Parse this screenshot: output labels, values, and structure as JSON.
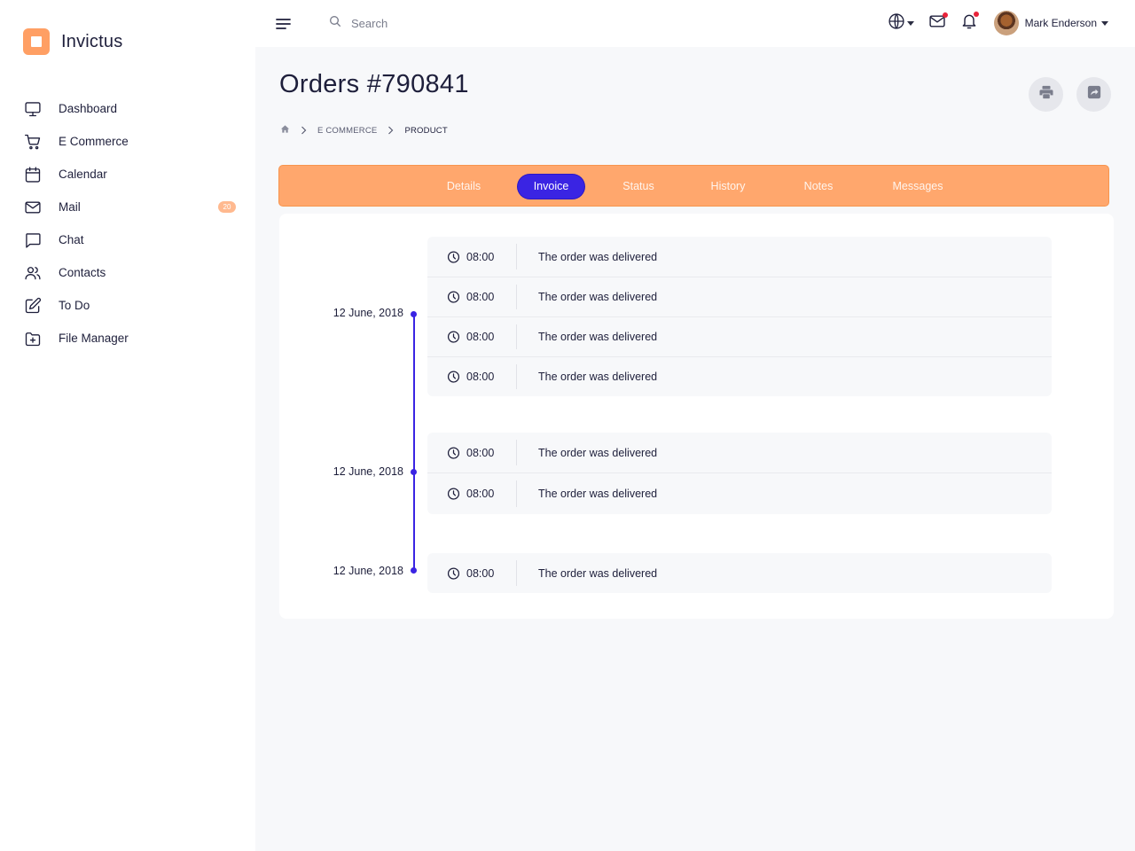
{
  "app": {
    "name": "Invictus"
  },
  "colors": {
    "accent": "#ffa76d",
    "primary": "#3a24e3",
    "badge": "#ffb98f",
    "notification_dot": "#e8233a"
  },
  "sidebar": {
    "items": [
      {
        "label": "Dashboard",
        "icon": "monitor-icon"
      },
      {
        "label": "E Commerce",
        "icon": "cart-icon"
      },
      {
        "label": "Calendar",
        "icon": "calendar-icon"
      },
      {
        "label": "Mail",
        "icon": "mail-icon",
        "badge": "20"
      },
      {
        "label": "Chat",
        "icon": "chat-icon"
      },
      {
        "label": "Contacts",
        "icon": "contacts-icon"
      },
      {
        "label": "To Do",
        "icon": "edit-icon"
      },
      {
        "label": "File Manager",
        "icon": "folder-plus-icon"
      }
    ]
  },
  "topbar": {
    "search_placeholder": "Search",
    "user_name": "Mark Enderson"
  },
  "page": {
    "title": "Orders #790841",
    "breadcrumb": [
      "E COMMERCE",
      "PRODUCT"
    ]
  },
  "tabs": [
    {
      "label": "Details"
    },
    {
      "label": "Invoice",
      "active": true
    },
    {
      "label": "Status"
    },
    {
      "label": "History"
    },
    {
      "label": "Notes"
    },
    {
      "label": "Messages"
    }
  ],
  "timeline": [
    {
      "date": "12 June, 2018",
      "events": [
        {
          "time": "08:00",
          "text": "The order was delivered"
        },
        {
          "time": "08:00",
          "text": "The order was delivered"
        },
        {
          "time": "08:00",
          "text": "The order was delivered"
        },
        {
          "time": "08:00",
          "text": "The order was delivered"
        }
      ]
    },
    {
      "date": "12 June, 2018",
      "events": [
        {
          "time": "08:00",
          "text": "The order was delivered"
        },
        {
          "time": "08:00",
          "text": "The order was delivered"
        }
      ]
    },
    {
      "date": "12 June, 2018",
      "events": [
        {
          "time": "08:00",
          "text": "The order was delivered"
        }
      ]
    }
  ]
}
